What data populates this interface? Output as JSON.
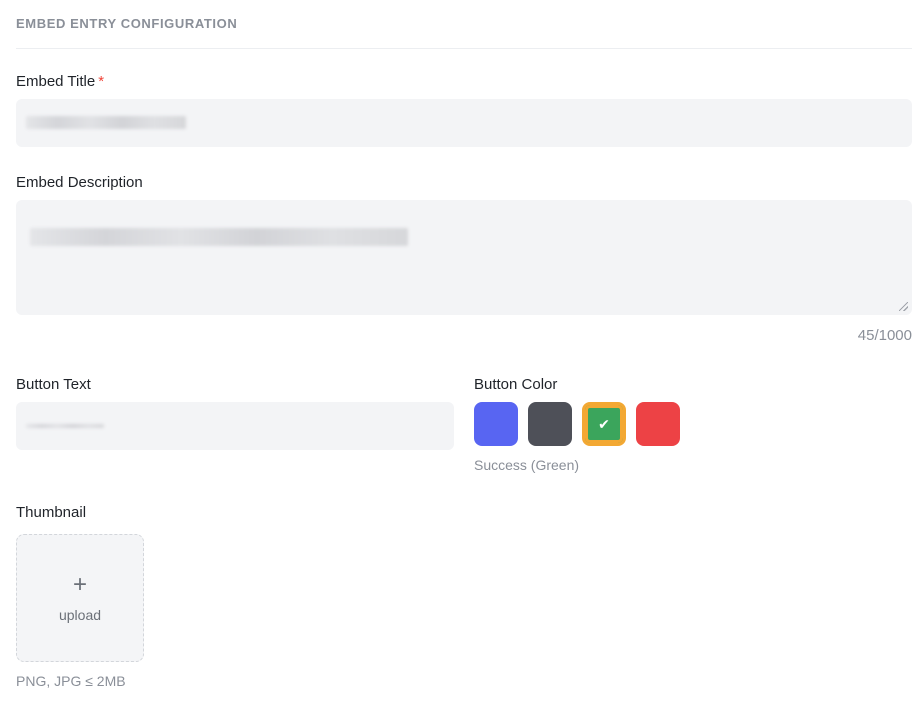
{
  "section": {
    "title": "EMBED ENTRY CONFIGURATION"
  },
  "embed_title": {
    "label": "Embed Title",
    "required_mark": "*"
  },
  "embed_description": {
    "label": "Embed Description",
    "counter": "45/1000"
  },
  "button_text": {
    "label": "Button Text"
  },
  "button_color": {
    "label": "Button Color",
    "selected_caption": "Success (Green)",
    "swatches": [
      {
        "color": "#5865f2",
        "selected": false
      },
      {
        "color": "#4e5058",
        "selected": false
      },
      {
        "color": "#3ba55c",
        "selected": true
      },
      {
        "color": "#ed4245",
        "selected": false
      }
    ]
  },
  "thumbnail": {
    "label": "Thumbnail",
    "plus_glyph": "+",
    "upload_label": "upload",
    "hint": "PNG, JPG ≤ 2MB"
  }
}
